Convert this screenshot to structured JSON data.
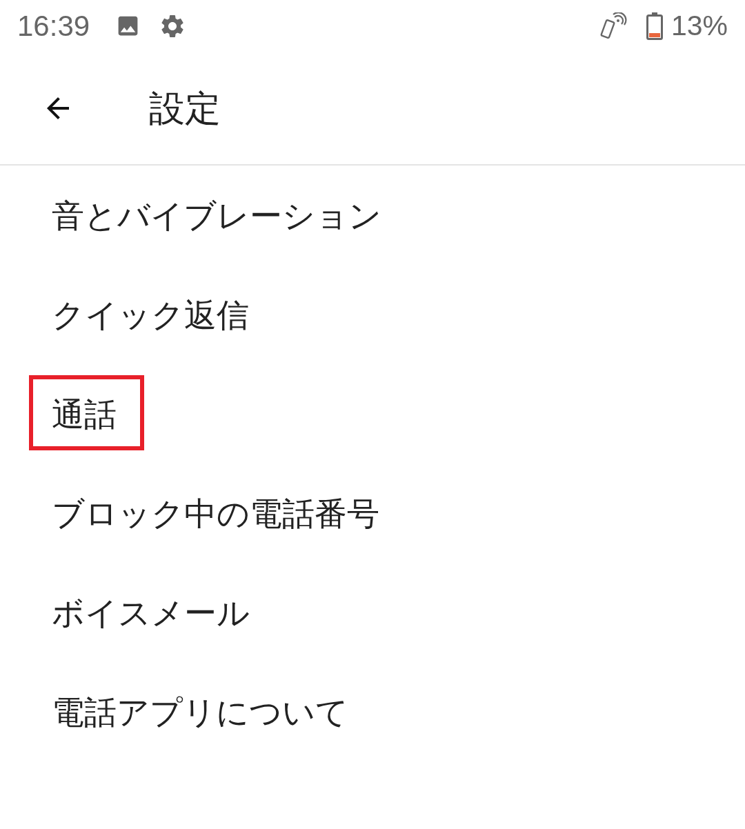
{
  "status_bar": {
    "time": "16:39",
    "battery": "13%"
  },
  "toolbar": {
    "title": "設定"
  },
  "items": [
    {
      "label": "音とバイブレーション",
      "highlighted": false
    },
    {
      "label": "クイック返信",
      "highlighted": false
    },
    {
      "label": "通話",
      "highlighted": true
    },
    {
      "label": "ブロック中の電話番号",
      "highlighted": false
    },
    {
      "label": "ボイスメール",
      "highlighted": false
    },
    {
      "label": "電話アプリについて",
      "highlighted": false
    }
  ]
}
